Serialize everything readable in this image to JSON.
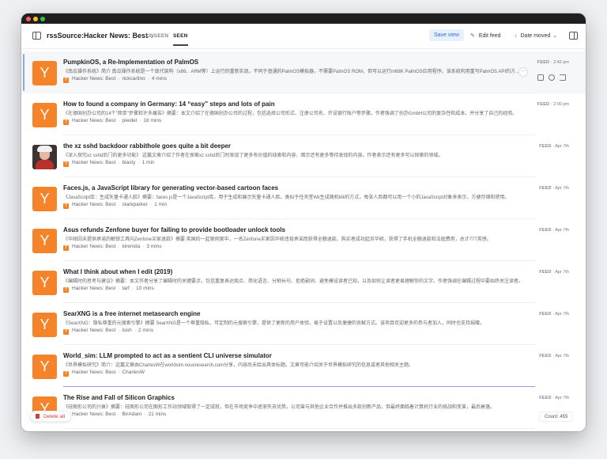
{
  "header": {
    "feed_title": "rssSource:Hacker News: Best",
    "tabs": [
      {
        "label": "UNSEEN"
      },
      {
        "label": "SEEN",
        "active": true
      }
    ],
    "save_view": "Save view",
    "edit_feed": "Edit feed",
    "sort_label": "Date moved"
  },
  "items": [
    {
      "title": "PumpkinOS, a Re-Implementation of PalmOS",
      "desc": "《南瓜操作系统》简介 南瓜操作系统是一个现代架构（x86、ARM等）上运行的重新实现。不同于普通的PalmOS模拟器，不需要PalmOS ROM，但可以运行m68K PalmOS应用程序。该系统利用重写PalmOS API的方式运行。",
      "source": "Hacker News: Best",
      "author": "rickcarlino",
      "read_time": "4 mins",
      "feed_label": "FEED",
      "time": "2:42 pm",
      "thumb": "Y"
    },
    {
      "title": "How to found a company in Germany: 14 “easy” steps and lots of pain",
      "desc": "《在德国创办公司的14个\"简单\"步骤和许多痛苦》摘要：本文介绍了在德国创办公司的过程，包括选择公司形式、注册公司名、开设银行账户等步骤。作者强调了创办GmbH公司的复杂性和成本。并分享了自己的经验。",
      "source": "Hacker News: Best",
      "author": "pieidel",
      "read_time": "18 mins",
      "feed_label": "FEED",
      "time": "2:00 pm",
      "thumb": "Y"
    },
    {
      "title": "the xz sshd backdoor rabbithole goes quite a bit deeper",
      "desc": "《深入探究xz sshd后门的更多功能》 这篇文章介绍了作者在探索xz sshd后门时发现了更多有价值的线索和内容，暗示还有更多等待发现的内容。作者表示还有更多可以探索的领域。",
      "source": "Hacker News: Best",
      "author": "blasty",
      "read_time": "1 min",
      "feed_label": "FEED",
      "time": "Apr 7th",
      "thumb": "photo"
    },
    {
      "title": "Faces.js, a JavaScript library for generating vector-based cartoon faces",
      "desc": "《JavaScript库：生成矢量卡通人脸》摘要：faces.js是一个JavaScript库，用于生成和展示矢量卡通人脸。类似于任天堂Wii生成随机Mii的方式，每张人脸都可以用一个小的JavaScript对象来表示，方便存储和使用。",
      "source": "Hacker News: Best",
      "author": "starkparker",
      "read_time": "1 min",
      "feed_label": "FEED",
      "time": "Apr 7th",
      "thumb": "Y"
    },
    {
      "title": "Asus refunds Zenfone buyer for failing to provide bootloader unlock tools",
      "desc": "《华硕因未提供承诺的解锁工具向Zenfone买家退款》摘要 英国的一起案例案中，一名Zenfone买家因华硕违背承诺而获得全额退款。购买者成功起诉华硕，获得了手机全额退款和法庭费用，总计777英镑。",
      "source": "Hacker News: Best",
      "author": "kirenida",
      "read_time": "3 mins",
      "feed_label": "FEED",
      "time": "Apr 7th",
      "thumb": "Y"
    },
    {
      "title": "What I think about when I edit (2019)",
      "desc": "《编辑时的思考与建议》摘要：本文作者分享了编辑时的关键要点，包括重复表达观点、简化语言、分割长句、拒绝副词、避免模设读者已知，以及如何让读者更易理解你的文字。作者强调在编辑过程中要始终关注读者。",
      "source": "Hacker News: Best",
      "author": "tarf",
      "read_time": "10 mins",
      "feed_label": "FEED",
      "time": "Apr 7th",
      "thumb": "Y"
    },
    {
      "title": "SearXNG is a free internet metasearch engine",
      "desc": "《SearXNG：隐私尊重的元搜索引擎》摘要 SearXNG是一个尊重隐私、可定制的元搜索引擎，提供了更新的用户体验，易于设置以及便捷的贡献方式。该项目欢迎更多的参与者加入，同时也支持捐赠。",
      "source": "Hacker News: Best",
      "author": "tosh",
      "read_time": "2 mins",
      "feed_label": "FEED",
      "time": "Apr 7th",
      "thumb": "Y"
    },
    {
      "title": "World_sim: LLM prompted to act as a sentient CLI universe simulator",
      "desc": "《世界模拟研究》简介：这篇文章由CharlesW在worldsim.nousresearch.com分享，内容尚未给出具体标题。文章可能介绍关于世界模拟研究的信息或者其他相关主题。",
      "source": "Hacker News: Best",
      "author": "CharlesW",
      "read_time": "",
      "feed_label": "FEED",
      "time": "Apr 7th",
      "thumb": "Y"
    },
    {
      "title": "The Rise and Fall of Silicon Graphics",
      "desc": "《硅图形公司的兴衰》摘要：硅图形公司在图形工作站领域取得了一定成就，但在市场竞争中逐渐失去优势。公司曾与其他企业合作并推出多款创新产品，但最终面临着计算机行业的挑战和变革，最后衰落。",
      "source": "Hacker News: Best",
      "author": "BirAdam",
      "read_time": "21 mins",
      "feed_label": "FEED",
      "time": "Apr 7th",
      "thumb": "Y"
    }
  ],
  "footer": {
    "delete_all": "Delete all",
    "count": "Count: 455"
  }
}
